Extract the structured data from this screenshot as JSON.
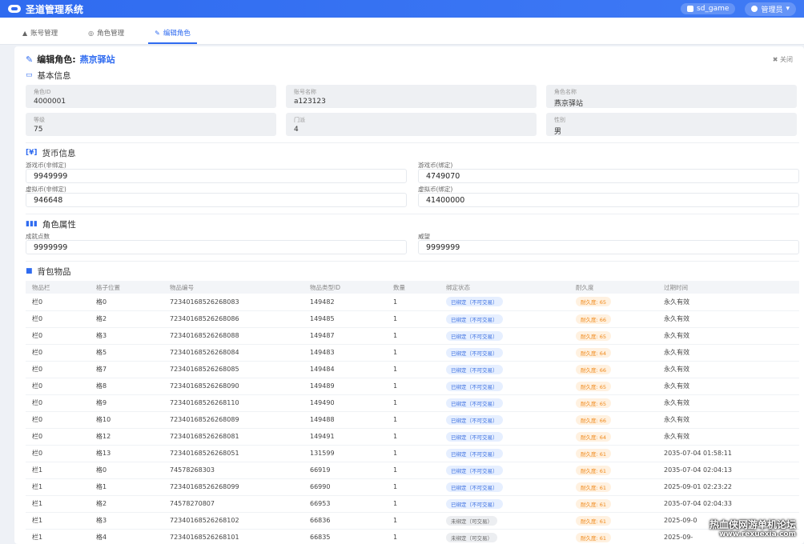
{
  "app": {
    "title": "圣道管理系统"
  },
  "header": {
    "server": "sd_game",
    "user": "管理员"
  },
  "tabs": [
    {
      "label": "账号管理",
      "icon": "▲"
    },
    {
      "label": "角色管理",
      "icon": "◎"
    },
    {
      "label": "编辑角色",
      "icon": "✎"
    }
  ],
  "panel": {
    "title_prefix": "编辑角色:",
    "role_name": "燕京驿站",
    "close_label": "关闭"
  },
  "basic": {
    "title": "基本信息",
    "fields": [
      {
        "label": "角色ID",
        "value": "4000001"
      },
      {
        "label": "账号名称",
        "value": "a123123"
      },
      {
        "label": "角色名称",
        "value": "燕京驿站"
      },
      {
        "label": "等级",
        "value": "75"
      },
      {
        "label": "门派",
        "value": "4"
      },
      {
        "label": "性别",
        "value": "男"
      }
    ]
  },
  "currency": {
    "title": "货币信息",
    "fields": [
      {
        "label": "游戏币(非绑定)",
        "value": "9949999"
      },
      {
        "label": "游戏币(绑定)",
        "value": "4749070"
      },
      {
        "label": "虚拟币(非绑定)",
        "value": "946648"
      },
      {
        "label": "虚拟币(绑定)",
        "value": "41400000"
      }
    ]
  },
  "attributes": {
    "title": "角色属性",
    "fields": [
      {
        "label": "成就点数",
        "value": "9999999"
      },
      {
        "label": "威望",
        "value": "9999999"
      }
    ]
  },
  "bag": {
    "title": "背包物品",
    "columns": [
      "物品栏",
      "格子位置",
      "物品编号",
      "物品类型ID",
      "数量",
      "绑定状态",
      "耐久度",
      "过期时间"
    ],
    "rows": [
      [
        "栏0",
        "格0",
        "72340168526268083",
        "149482",
        "1",
        "已绑定（不可交易）",
        "耐久度: 65",
        "永久有效",
        "blue"
      ],
      [
        "栏0",
        "格2",
        "72340168526268086",
        "149485",
        "1",
        "已绑定（不可交易）",
        "耐久度: 66",
        "永久有效",
        "blue"
      ],
      [
        "栏0",
        "格3",
        "72340168526268088",
        "149487",
        "1",
        "已绑定（不可交易）",
        "耐久度: 65",
        "永久有效",
        "blue"
      ],
      [
        "栏0",
        "格5",
        "72340168526268084",
        "149483",
        "1",
        "已绑定（不可交易）",
        "耐久度: 64",
        "永久有效",
        "blue"
      ],
      [
        "栏0",
        "格7",
        "72340168526268085",
        "149484",
        "1",
        "已绑定（不可交易）",
        "耐久度: 66",
        "永久有效",
        "blue"
      ],
      [
        "栏0",
        "格8",
        "72340168526268090",
        "149489",
        "1",
        "已绑定（不可交易）",
        "耐久度: 65",
        "永久有效",
        "blue"
      ],
      [
        "栏0",
        "格9",
        "72340168526268110",
        "149490",
        "1",
        "已绑定（不可交易）",
        "耐久度: 65",
        "永久有效",
        "blue"
      ],
      [
        "栏0",
        "格10",
        "72340168526268089",
        "149488",
        "1",
        "已绑定（不可交易）",
        "耐久度: 66",
        "永久有效",
        "blue"
      ],
      [
        "栏0",
        "格12",
        "72340168526268081",
        "149491",
        "1",
        "已绑定（不可交易）",
        "耐久度: 64",
        "永久有效",
        "blue"
      ],
      [
        "栏0",
        "格13",
        "72340168526268051",
        "131599",
        "1",
        "已绑定（不可交易）",
        "耐久度: 61",
        "2035-07-04 01:58:11",
        "blue"
      ],
      [
        "栏1",
        "格0",
        "74578268303",
        "66919",
        "1",
        "已绑定（不可交易）",
        "耐久度: 61",
        "2035-07-04 02:04:13",
        "blue"
      ],
      [
        "栏1",
        "格1",
        "72340168526268099",
        "66990",
        "1",
        "已绑定（不可交易）",
        "耐久度: 61",
        "2025-09-01 02:23:22",
        "blue"
      ],
      [
        "栏1",
        "格2",
        "74578270807",
        "66953",
        "1",
        "已绑定（不可交易）",
        "耐久度: 61",
        "2035-07-04 02:04:33",
        "blue"
      ],
      [
        "栏1",
        "格3",
        "72340168526268102",
        "66836",
        "1",
        "未绑定（可交易）",
        "耐久度: 61",
        "2025-09-0",
        "gray"
      ],
      [
        "栏1",
        "格4",
        "72340168526268101",
        "66835",
        "1",
        "未绑定（可交易）",
        "耐久度: 61",
        "2025-09-",
        "gray"
      ]
    ]
  },
  "watermark": {
    "line1": "热血侠网游单机论坛",
    "line2": "www.rexuexia.com"
  }
}
